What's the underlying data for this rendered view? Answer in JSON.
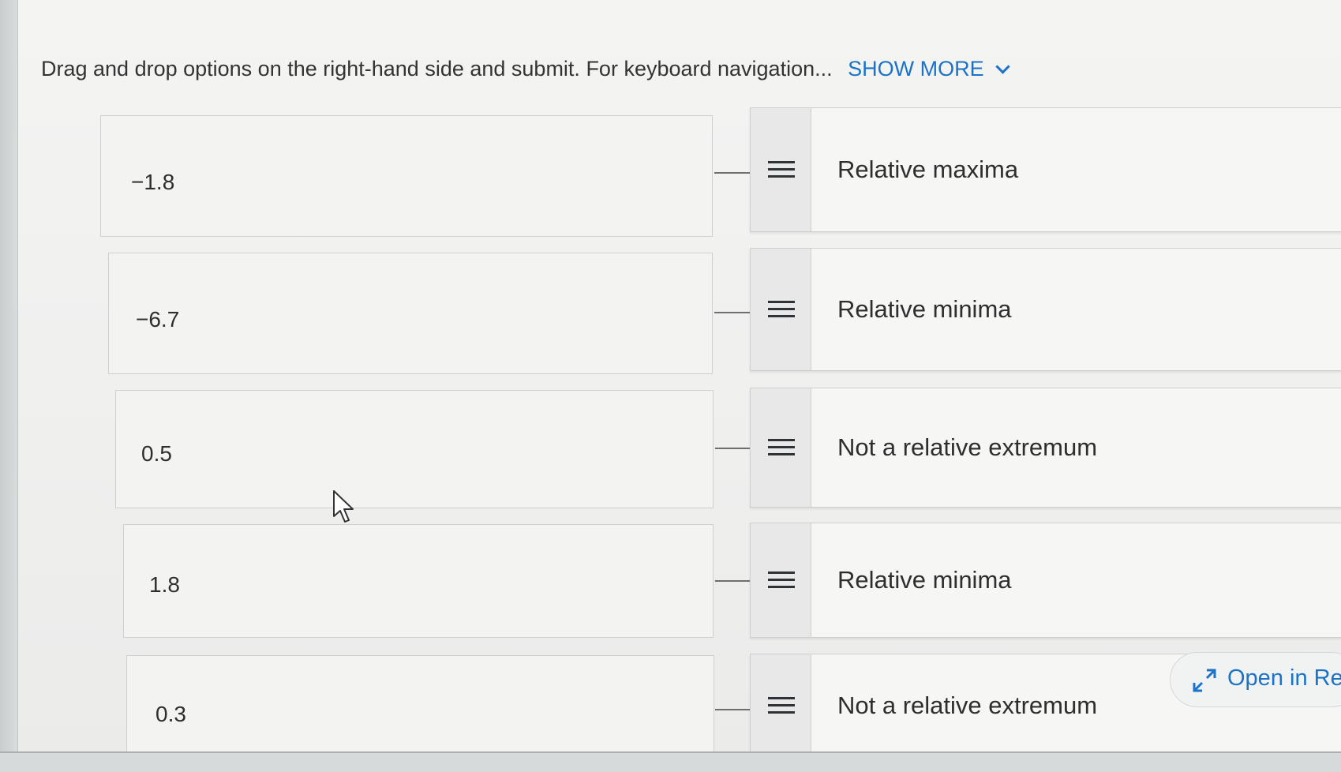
{
  "instructions": {
    "text": "Drag and drop options on the right-hand side and submit. For keyboard navigation...",
    "show_more": "SHOW MORE"
  },
  "pairs": [
    {
      "value": "−1.8",
      "option": "Relative maxima"
    },
    {
      "value": "−6.7",
      "option": "Relative minima"
    },
    {
      "value": "0.5",
      "option": "Not a relative extremum"
    },
    {
      "value": "1.8",
      "option": "Relative minima"
    },
    {
      "value": "0.3",
      "option": "Not a relative extremum"
    }
  ],
  "open_button": {
    "label": "Open in Re"
  },
  "icons": {
    "drag_handle": "drag-handle-icon",
    "expand": "expand-arrows-icon",
    "chevron": "chevron-down-icon",
    "cursor": "mouse-cursor-icon"
  },
  "colors": {
    "accent": "#1a73c9"
  }
}
